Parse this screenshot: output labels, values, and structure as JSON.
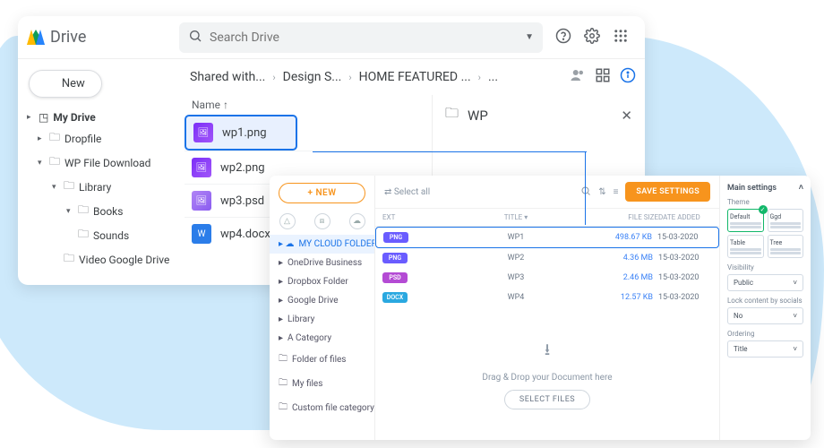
{
  "drive": {
    "app": "Drive",
    "search_placeholder": "Search Drive",
    "new_btn": "New",
    "tree": {
      "root": "My Drive",
      "n0": "Dropfile",
      "n1": "WP File Download",
      "n2": "Library",
      "n3": "Books",
      "n4": "Sounds",
      "n5": "Video Google Drive"
    },
    "crumbs": {
      "c0": "Shared with...",
      "c1": "Design S...",
      "c2": "HOME FEATURED ...",
      "c3": "..."
    },
    "col_name": "Name",
    "files": {
      "f0": "wp1.png",
      "f1": "wp2.png",
      "f2": "wp3.psd",
      "f3": "wp4.docx"
    },
    "wp_panel": "WP"
  },
  "wfd": {
    "new_btn": "+ NEW",
    "side": {
      "s0": "MY CLOUD FOLDER",
      "s1": "OneDrive Business",
      "s2": "Dropbox Folder",
      "s3": "Google Drive",
      "s4": "Library",
      "s5": "A Category",
      "s6": "Folder of files",
      "s7": "My files",
      "s8": "Custom file category"
    },
    "bar": {
      "select_all": "Select all",
      "save": "SAVE SETTINGS"
    },
    "hdr": {
      "ext": "EXT",
      "title": "TITLE",
      "size": "FILE SIZE",
      "date": "DATE ADDED"
    },
    "rows": [
      {
        "ext": "PNG",
        "title": "WP1",
        "size": "498.67 KB",
        "date": "15-03-2020",
        "cls": "b-png"
      },
      {
        "ext": "PNG",
        "title": "WP2",
        "size": "4.36 MB",
        "date": "15-03-2020",
        "cls": "b-png"
      },
      {
        "ext": "PSD",
        "title": "WP3",
        "size": "2.46 MB",
        "date": "15-03-2020",
        "cls": "b-psd"
      },
      {
        "ext": "DOCX",
        "title": "WP4",
        "size": "12.57 KB",
        "date": "15-03-2020",
        "cls": "b-docx"
      }
    ],
    "drop": {
      "hint": "Drag & Drop your Document here",
      "btn": "SELECT FILES"
    },
    "settings": {
      "title": "Main settings",
      "theme": "Theme",
      "theme_a": "Default",
      "theme_b": "Ggd",
      "theme_c": "Table",
      "theme_d": "Tree",
      "visibility": "Visibility",
      "visibility_v": "Public",
      "lock": "Lock content by socials",
      "lock_v": "No",
      "ordering": "Ordering",
      "ordering_v": "Title"
    }
  }
}
